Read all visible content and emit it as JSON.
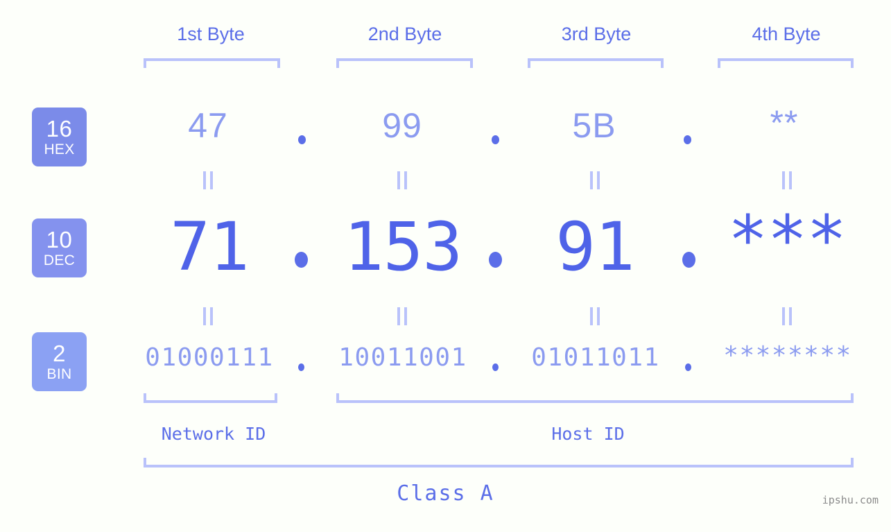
{
  "meta": {
    "background": "#fdfffa",
    "accent": "#5b6ee8",
    "accent_light": "#8b9bf0",
    "bracket": "#b9c2fa",
    "watermark_text": "ipshu.com"
  },
  "headers": {
    "byte1": "1st Byte",
    "byte2": "2nd Byte",
    "byte3": "3rd Byte",
    "byte4": "4th Byte"
  },
  "radix": {
    "hex": {
      "base": "16",
      "label": "HEX",
      "color": "#7b8be9"
    },
    "dec": {
      "base": "10",
      "label": "DEC",
      "color": "#8492ee"
    },
    "bin": {
      "base": "2",
      "label": "BIN",
      "color": "#8ba1f3"
    }
  },
  "rows": {
    "hex": {
      "b1": "47",
      "b2": "99",
      "b3": "5B",
      "b4": "**"
    },
    "dec": {
      "b1": "71",
      "b2": "153",
      "b3": "91",
      "b4": "***"
    },
    "bin": {
      "b1": "01000111",
      "b2": "10011001",
      "b3": "01011011",
      "b4": "********"
    }
  },
  "separator": ".",
  "equals_symbol": "=",
  "footer": {
    "network_id": "Network ID",
    "host_id": "Host ID",
    "class": "Class A"
  }
}
